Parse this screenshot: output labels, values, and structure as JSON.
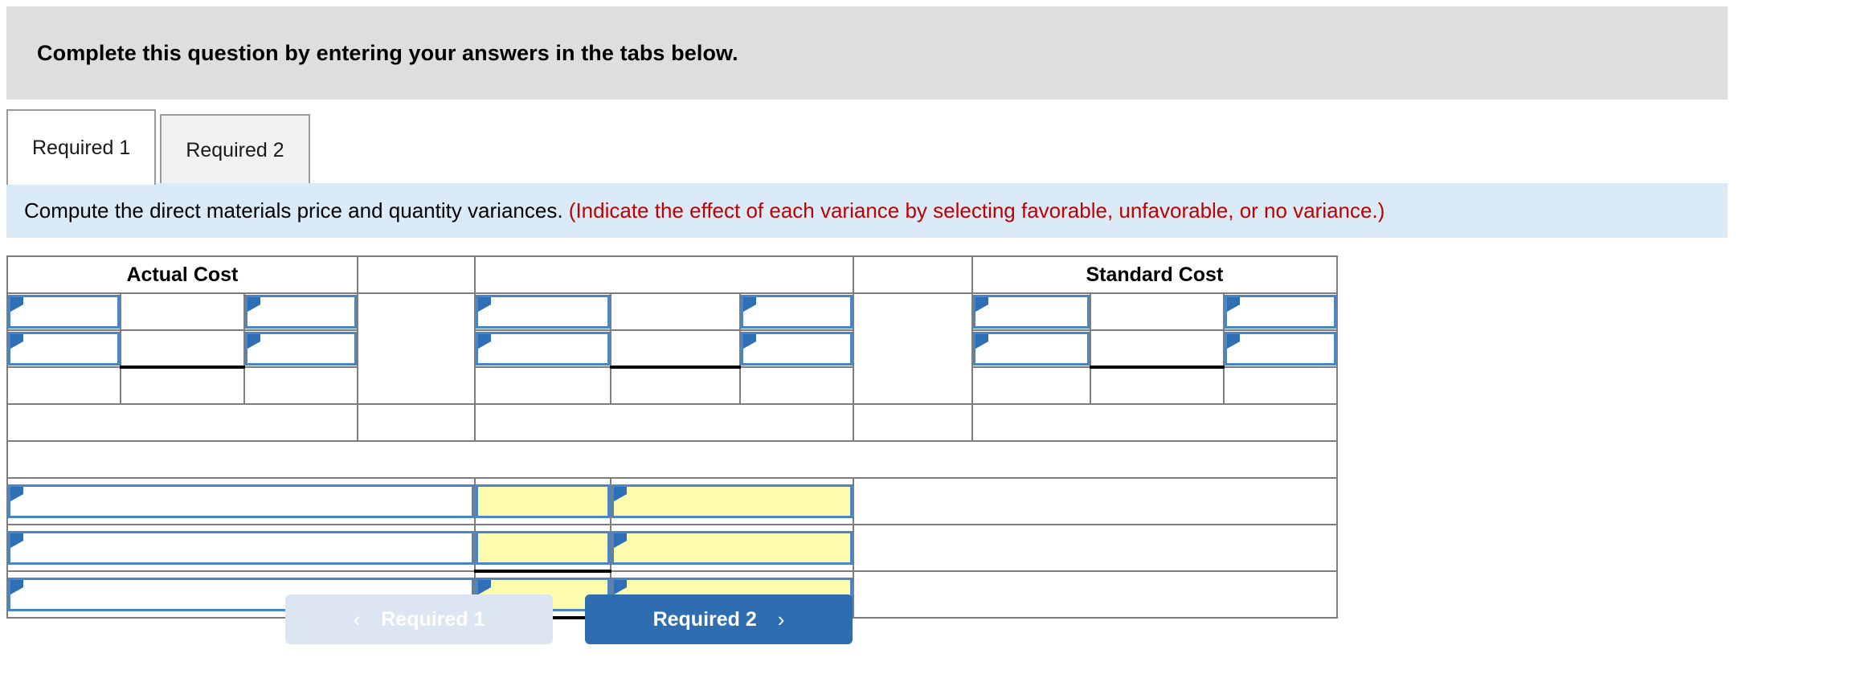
{
  "banner": {
    "text": "Complete this question by entering your answers in the tabs below."
  },
  "tabs": [
    {
      "label": "Required 1",
      "active": true
    },
    {
      "label": "Required 2",
      "active": false
    }
  ],
  "instruction": {
    "main": "Compute the direct materials price and quantity variances.",
    "hint": "(Indicate the effect of each variance by selecting favorable, unfavorable, or no variance.)"
  },
  "worksheet": {
    "headers": {
      "actual_cost": "Actual Cost",
      "middle": "",
      "standard_cost": "Standard Cost"
    },
    "cells": {
      "r1c1": "",
      "r1c2": "",
      "r1c3": "",
      "r1c5": "",
      "r1c6": "",
      "r1c7": "",
      "r1c9": "",
      "r1c10": "",
      "r1c11": "",
      "r2c1": "",
      "r2c2": "",
      "r2c3": "",
      "r2c5": "",
      "r2c6": "",
      "r2c7": "",
      "r2c9": "",
      "r2c10": "",
      "r2c11": "",
      "r3c1": "",
      "r3c2": "",
      "r3c3": "",
      "r3c5": "",
      "r3c6": "",
      "r3c7": "",
      "r3c9": "",
      "r3c10": "",
      "r3c11": "",
      "r4_left": "",
      "r4_gap1": "",
      "r4_mid": "",
      "r4_gap2": "",
      "r4_right": "",
      "r5_full": "",
      "v1_label": "",
      "v1_amount": "",
      "v1_effect": "",
      "v2_label": "",
      "v2_amount": "",
      "v2_effect": "",
      "v3_label": "",
      "v3_amount": "",
      "v3_effect": ""
    }
  },
  "footer": {
    "prev_label": "Required 1",
    "next_label": "Required 2",
    "prev_chevron": "‹",
    "next_chevron": "›"
  },
  "colors": {
    "header_blue": "#74aae4",
    "input_border": "#4a86c5",
    "yellow": "#fffcaf",
    "instruction_bg": "#daeaf7",
    "banner_bg": "#dededf",
    "hint_red": "#c00000",
    "button_blue": "#2e6daf",
    "button_disabled": "#dbe6f2"
  }
}
